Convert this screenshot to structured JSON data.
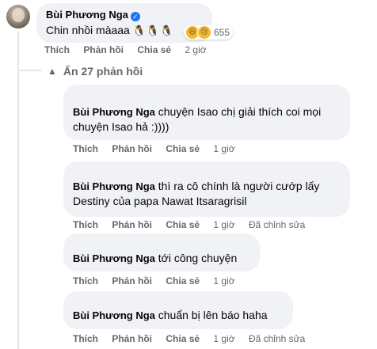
{
  "root_comment": {
    "name": "Bùi Phương Nga",
    "text": "Chin nhồi màaaa",
    "emoji_inline": "🐧🐧🐧",
    "reaction_count": "655",
    "reaction_emojis": [
      "😆",
      "😢"
    ],
    "actions": {
      "like": "Thích",
      "reply": "Phản hồi",
      "share": "Chia sẻ"
    },
    "time": "2 giờ"
  },
  "more_replies": {
    "label": "Ẩn 27 phản hồi",
    "icon": "chevron-up-icon"
  },
  "replies": [
    {
      "tag": "Bùi Phương Nga",
      "text": "chuyện Isao chị giải thích coi mọi chuyện Isao hả :))))",
      "actions": {
        "like": "Thích",
        "reply": "Phản hồi",
        "share": "Chia sẻ"
      },
      "time": "1 giờ",
      "edited": ""
    },
    {
      "tag": "Bùi Phương Nga",
      "text": "thì ra cô chính là người cướp lấy Destiny của papa Nawat Itsaragrisil",
      "actions": {
        "like": "Thích",
        "reply": "Phản hồi",
        "share": "Chia sẻ"
      },
      "time": "1 giờ",
      "edited": "Đã chỉnh sửa"
    },
    {
      "tag": "Bùi Phương Nga",
      "text": "tới công chuyện",
      "actions": {
        "like": "Thích",
        "reply": "Phản hồi",
        "share": "Chia sẻ"
      },
      "time": "1 giờ",
      "edited": ""
    },
    {
      "tag": "Bùi Phương Nga",
      "text": "chuẩn bị lên báo haha",
      "actions": {
        "like": "Thích",
        "reply": "Phản hồi",
        "share": "Chia sẻ"
      },
      "time": "1 giờ",
      "edited": "Đã chỉnh sửa"
    }
  ]
}
